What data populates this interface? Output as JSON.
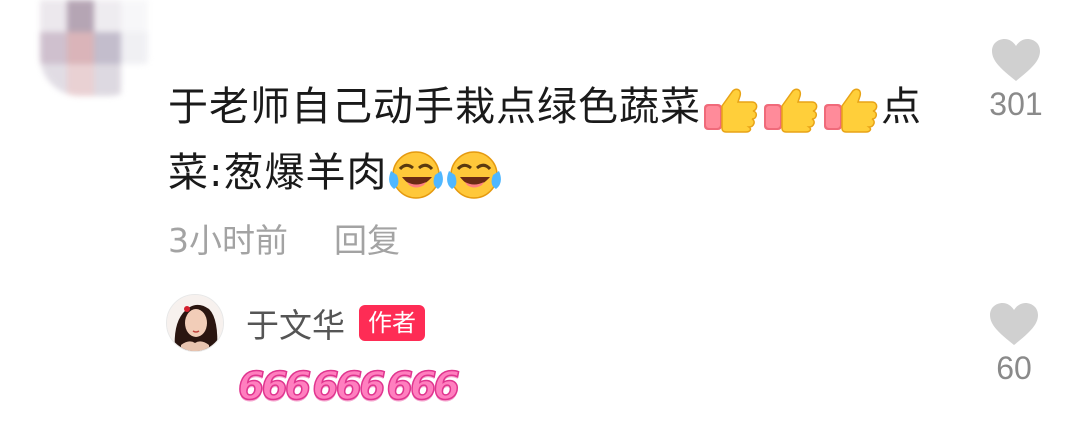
{
  "comment": {
    "text_line1": "于老师自己动手栽点绿色蔬菜",
    "text_suffix1": "点",
    "text_line2": "菜:葱爆羊肉",
    "emoji_thumbs": "thumbs-up-icon",
    "emoji_laugh": "laughing-tears-icon",
    "time": "3小时前",
    "reply_label": "回复",
    "likes": "301"
  },
  "reply": {
    "author_name": "于文华",
    "author_badge": "作者",
    "sticker_text": [
      "666",
      "666",
      "666"
    ],
    "likes": "60"
  },
  "colors": {
    "badge": "#fe2c55",
    "heart": "#d0d0d0",
    "meta_text": "#a3a3a3",
    "sticker": "#ff7fbf"
  }
}
